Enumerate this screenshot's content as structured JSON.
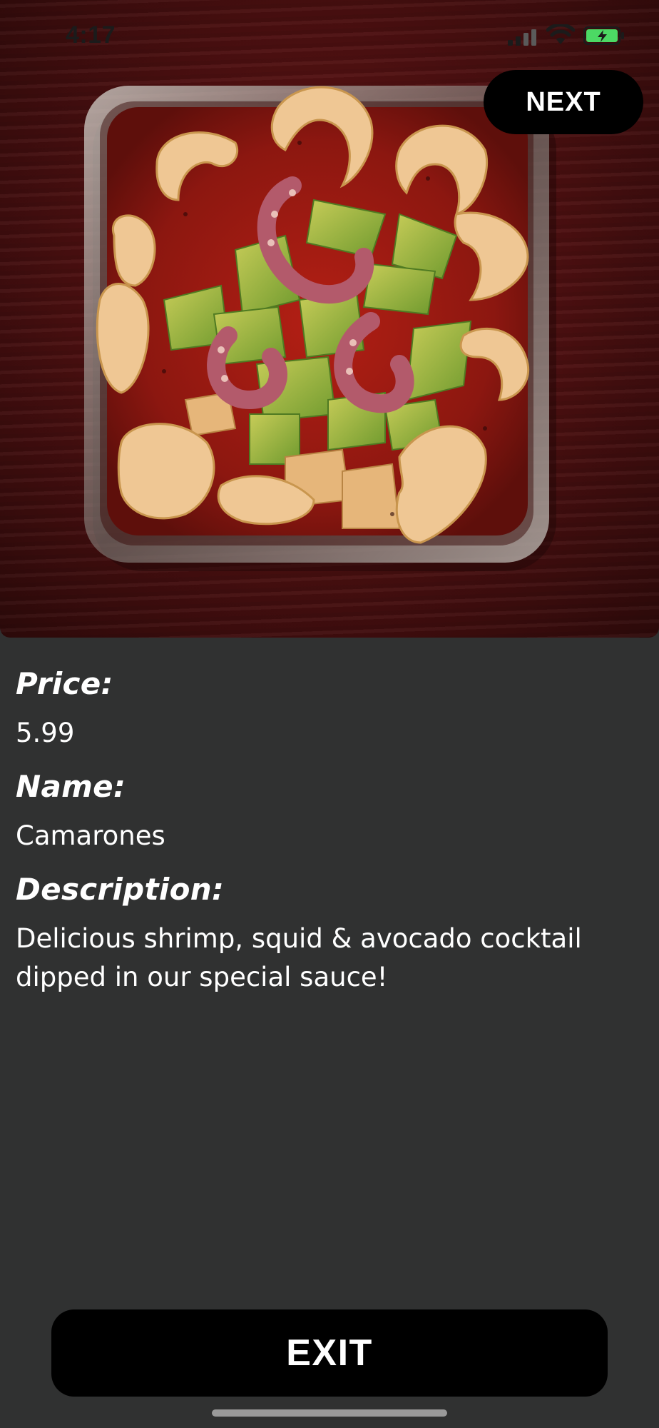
{
  "status_bar": {
    "time": "4:17",
    "icons": [
      "signal-icon",
      "wifi-icon",
      "battery-charging-icon"
    ]
  },
  "hero": {
    "image_subject": "ceviche cocktail in glass dish with avocado, octopus and chicharron",
    "next_label": "NEXT"
  },
  "details": {
    "price_label": "Price:",
    "price_value": "5.99",
    "name_label": "Name:",
    "name_value": "Camarones",
    "description_label": "Description:",
    "description_value": "Delicious shrimp, squid & avocado cocktail dipped in our special sauce!"
  },
  "footer": {
    "exit_label": "EXIT"
  },
  "colors": {
    "background": "#303131",
    "button_bg": "#000000",
    "button_text": "#ffffff",
    "text": "#ffffff",
    "battery_green": "#4cd964"
  }
}
